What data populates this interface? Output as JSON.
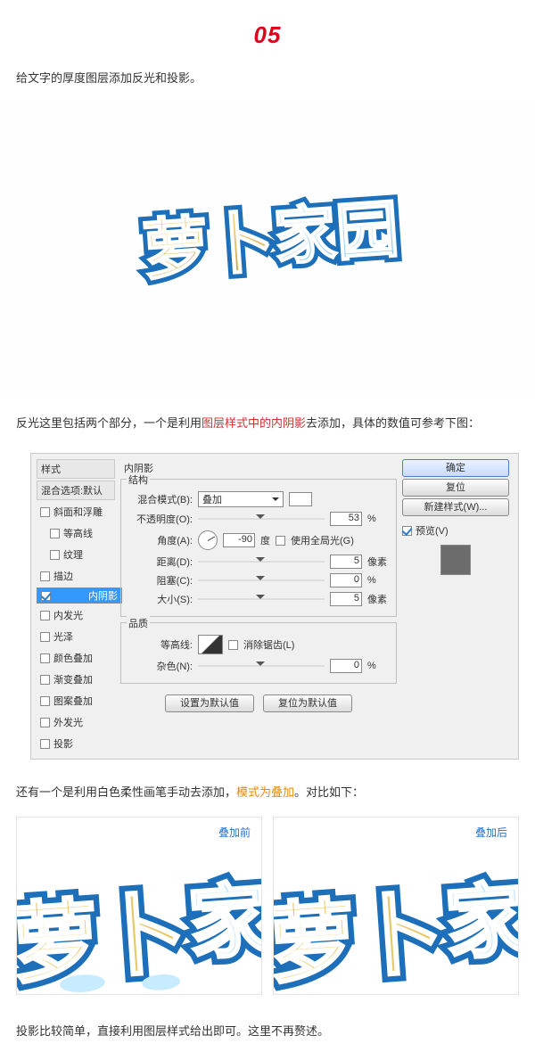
{
  "step": "05",
  "intro": "给文字的厚度图层添加反光和投影。",
  "para1_a": "反光这里包括两个部分，一个是利用",
  "para1_em": "图层样式中的内阴影",
  "para1_b": "去添加，具体的数值可参考下图：",
  "dialog": {
    "styles_head": "样式",
    "blend_head": "混合选项:默认",
    "items": {
      "bevel": "斜面和浮雕",
      "contour": "等高线",
      "texture": "纹理",
      "stroke": "描边",
      "inner_shadow": "内阴影",
      "inner_glow": "内发光",
      "satin": "光泽",
      "color_overlay": "颜色叠加",
      "gradient_overlay": "渐变叠加",
      "pattern_overlay": "图案叠加",
      "outer_glow": "外发光",
      "drop_shadow": "投影"
    },
    "panel_title": "内阴影",
    "group_structure": "结构",
    "labels": {
      "blend_mode": "混合模式(B):",
      "opacity": "不透明度(O):",
      "angle": "角度(A):",
      "distance": "距离(D):",
      "choke": "阻塞(C):",
      "size": "大小(S):",
      "contour_l": "等高线:",
      "noise": "杂色(N):"
    },
    "blend_value": "叠加",
    "opacity_v": "53",
    "angle_v": "-90",
    "angle_unit": "度",
    "global_light": "使用全局光(G)",
    "distance_v": "5",
    "choke_v": "0",
    "size_v": "5",
    "px": "像素",
    "pct": "%",
    "group_quality": "品质",
    "antialias": "消除锯齿(L)",
    "noise_v": "0",
    "btn_set_default": "设置为默认值",
    "btn_reset_default": "复位为默认值",
    "btn_ok": "确定",
    "btn_cancel": "复位",
    "btn_new_style": "新建样式(W)...",
    "preview_label": "预览(V)"
  },
  "para2_a": "还有一个是利用白色柔性画笔手动去添加，",
  "para2_em": "模式为叠加",
  "para2_b": "。对比如下：",
  "compare": {
    "before": "叠加前",
    "after": "叠加后"
  },
  "footer": "投影比较简单，直接利用图层样式给出即可。这里不再赘述。"
}
